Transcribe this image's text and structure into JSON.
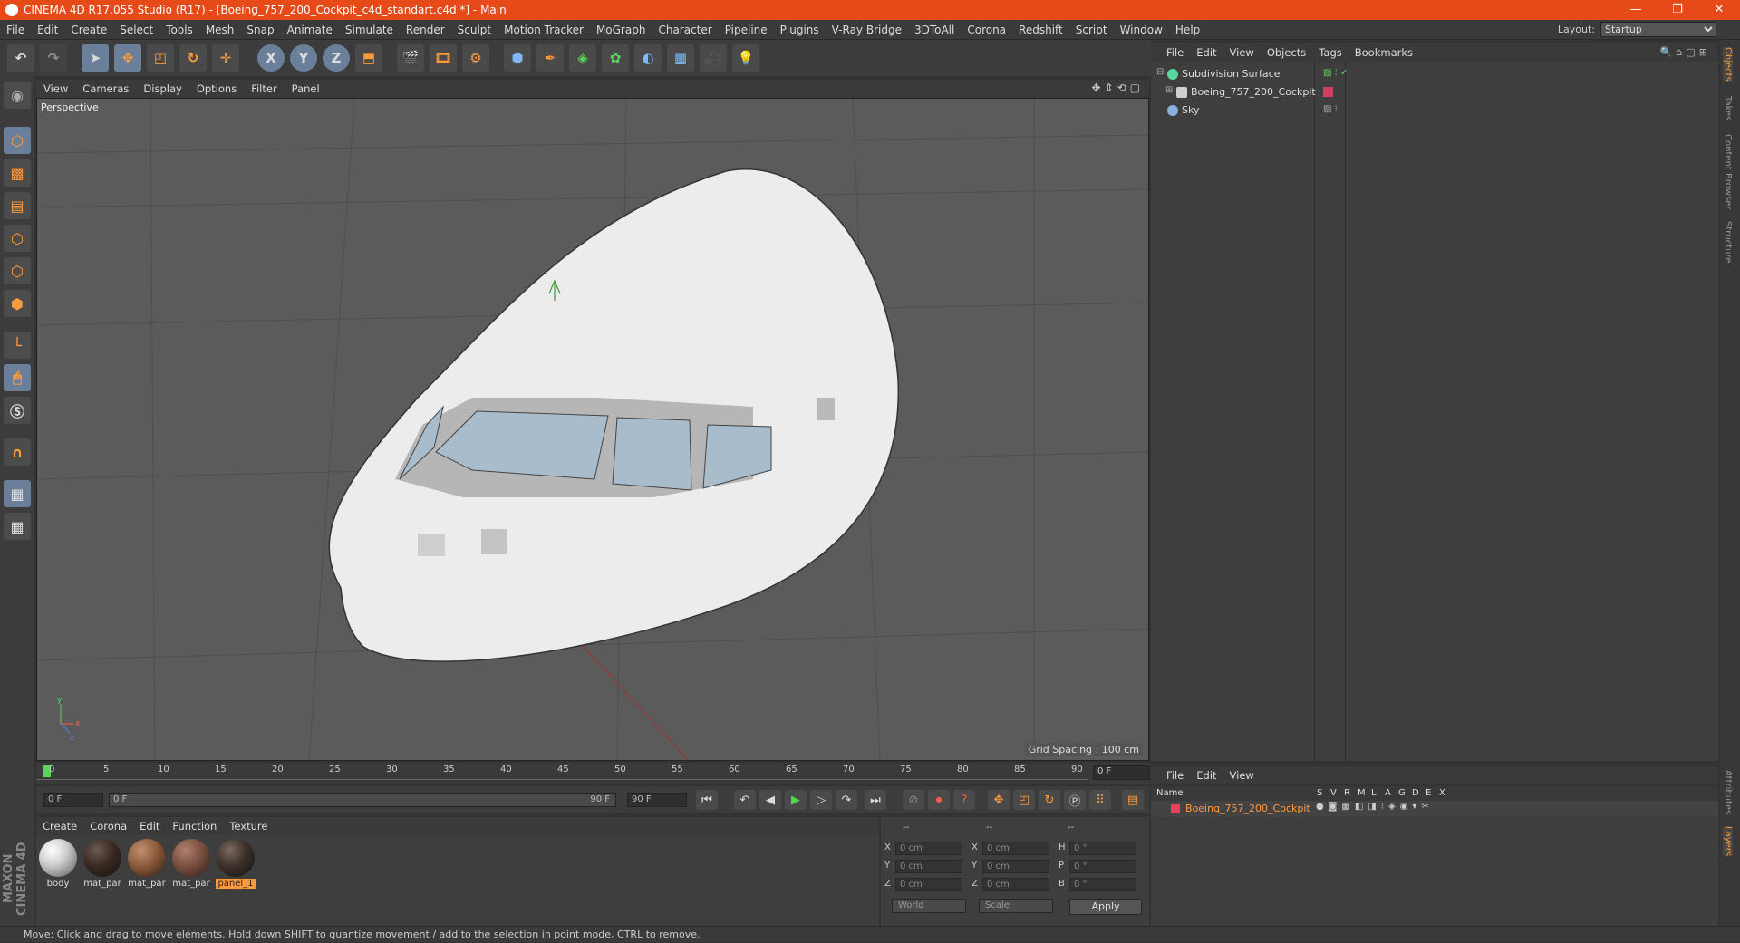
{
  "window": {
    "title": "CINEMA 4D R17.055 Studio (R17) - [Boeing_757_200_Cockpit_c4d_standart.c4d *] - Main",
    "controls": [
      "—",
      "❐",
      "✕"
    ]
  },
  "menubar": {
    "items": [
      "File",
      "Edit",
      "Create",
      "Select",
      "Tools",
      "Mesh",
      "Snap",
      "Animate",
      "Simulate",
      "Render",
      "Sculpt",
      "Motion Tracker",
      "MoGraph",
      "Character",
      "Pipeline",
      "Plugins",
      "V-Ray Bridge",
      "3DToAll",
      "Corona",
      "Redshift",
      "Script",
      "Window",
      "Help"
    ],
    "layout_label": "Layout:",
    "layout_value": "Startup"
  },
  "toolbar": {
    "axis_x": "X",
    "axis_y": "Y",
    "axis_z": "Z"
  },
  "viewport": {
    "menu": [
      "View",
      "Cameras",
      "Display",
      "Options",
      "Filter",
      "Panel"
    ],
    "camera_label": "Perspective",
    "grid_spacing": "Grid Spacing : 100 cm",
    "axis_labels": [
      "y",
      "x",
      "z"
    ]
  },
  "timeline": {
    "ticks": [
      "0",
      "5",
      "10",
      "15",
      "20",
      "25",
      "30",
      "35",
      "40",
      "45",
      "50",
      "55",
      "60",
      "65",
      "70",
      "75",
      "80",
      "85",
      "90"
    ],
    "current_frame": "0 F",
    "start_field": "0 F",
    "range_start": "0 F",
    "range_end": "90 F",
    "end_field": "90 F"
  },
  "material_manager": {
    "menu": [
      "Create",
      "Corona",
      "Edit",
      "Function",
      "Texture"
    ],
    "materials": [
      {
        "name": "body",
        "color": "#cfcfcf",
        "selected": false
      },
      {
        "name": "mat_par",
        "color": "#3a2a22",
        "selected": false
      },
      {
        "name": "mat_par",
        "color": "#8a5a3a",
        "selected": false
      },
      {
        "name": "mat_par",
        "color": "#7a5040",
        "selected": false
      },
      {
        "name": "panel_1",
        "color": "#3d302a",
        "selected": true
      }
    ]
  },
  "coordinates": {
    "headers": [
      "--",
      "--",
      "--"
    ],
    "rows": [
      {
        "axis": "X",
        "pos": "0 cm",
        "axis2": "X",
        "size": "0 cm",
        "rot_label": "H",
        "rot": "0 °"
      },
      {
        "axis": "Y",
        "pos": "0 cm",
        "axis2": "Y",
        "size": "0 cm",
        "rot_label": "P",
        "rot": "0 °"
      },
      {
        "axis": "Z",
        "pos": "0 cm",
        "axis2": "Z",
        "size": "0 cm",
        "rot_label": "B",
        "rot": "0 °"
      }
    ],
    "mode": "World",
    "transform": "Scale",
    "apply": "Apply"
  },
  "object_manager": {
    "menu": [
      "File",
      "Edit",
      "View",
      "Objects",
      "Tags",
      "Bookmarks"
    ],
    "objects": [
      {
        "name": "Subdivision Surface",
        "icon_color": "#5ad6a0"
      },
      {
        "name": "Boeing_757_200_Cockpit",
        "icon_color": "#d0d0d0"
      },
      {
        "name": "Sky",
        "icon_color": "#8ab0e0"
      }
    ]
  },
  "layer_manager": {
    "menu": [
      "File",
      "Edit",
      "View"
    ],
    "columns": [
      "Name",
      "S",
      "V",
      "R",
      "M",
      "L",
      "A",
      "G",
      "D",
      "E",
      "X"
    ],
    "layers": [
      {
        "name": "Boeing_757_200_Cockpit",
        "color": "#e8405a"
      }
    ]
  },
  "right_tabs": [
    "Objects",
    "Takes",
    "Content Browser",
    "Structure",
    "Attributes",
    "Layers"
  ],
  "brand": "MAXON CINEMA 4D",
  "status": "Move: Click and drag to move elements. Hold down SHIFT to quantize movement / add to the selection in point mode, CTRL to remove.",
  "colors": {
    "title_bar": "#e64a19",
    "accent": "#ff9a3c",
    "viewport_bg": "#5b5b5b"
  }
}
